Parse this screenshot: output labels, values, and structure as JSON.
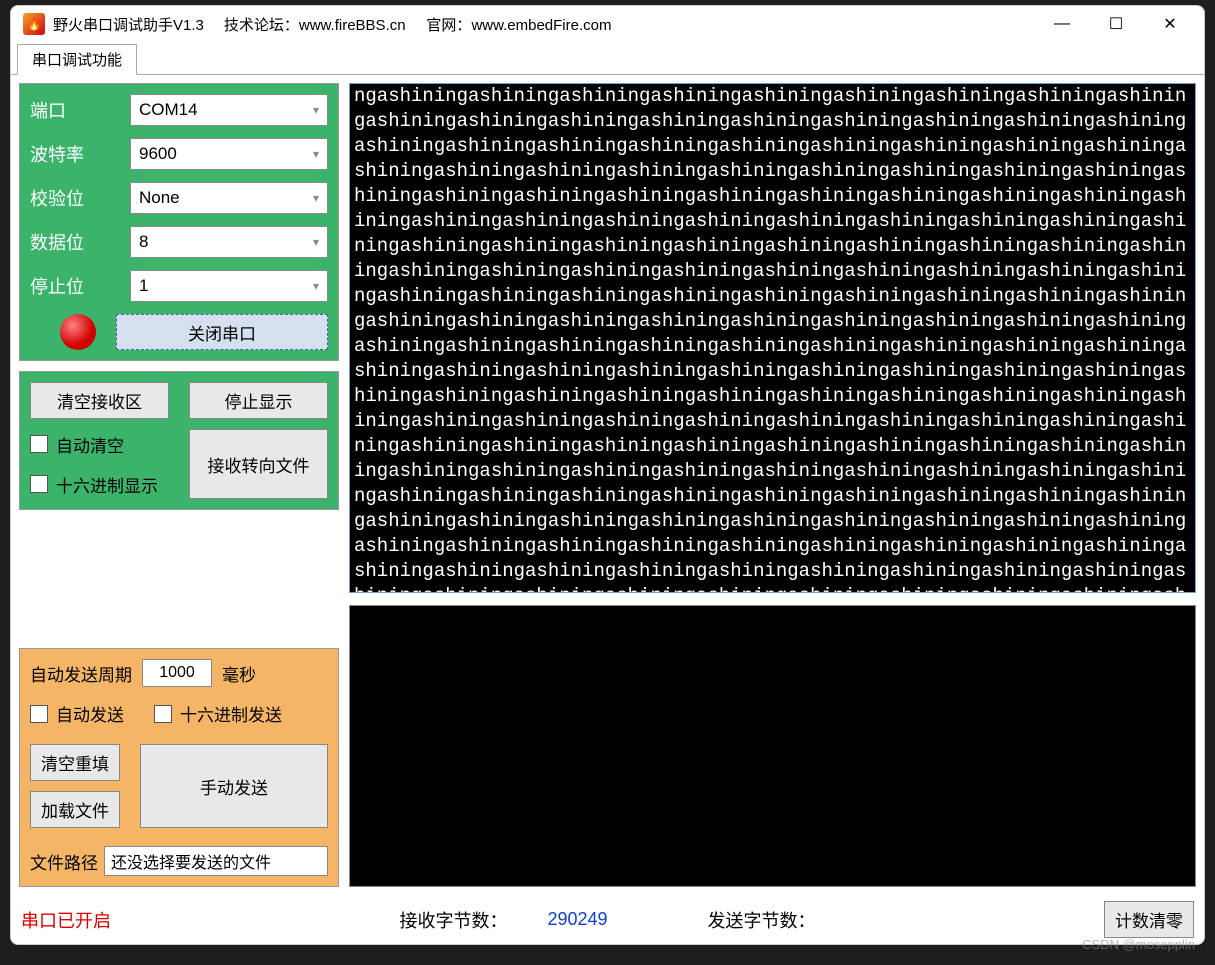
{
  "titlebar": {
    "app_title": "野火串口调试助手V1.3",
    "forum_label": "技术论坛：",
    "forum_url": "www.fireBBS.cn",
    "site_label": "官网：",
    "site_url": "www.embedFire.com"
  },
  "tabs": {
    "main": "串口调试功能"
  },
  "config": {
    "port_label": "端口",
    "port_value": "COM14",
    "baud_label": "波特率",
    "baud_value": "9600",
    "parity_label": "校验位",
    "parity_value": "None",
    "data_label": "数据位",
    "data_value": "8",
    "stop_label": "停止位",
    "stop_value": "1",
    "close_port": "关闭串口"
  },
  "rx_panel": {
    "clear": "清空接收区",
    "stop_disp": "停止显示",
    "auto_clear": "自动清空",
    "hex_disp": "十六进制显示",
    "to_file": "接收转向文件"
  },
  "tx_panel": {
    "auto_period_label": "自动发送周期",
    "period_value": "1000",
    "ms_label": "毫秒",
    "auto_send": "自动发送",
    "hex_send": "十六进制发送",
    "clear_refill": "清空重填",
    "load_file": "加载文件",
    "manual_send": "手动发送",
    "file_path_label": "文件路径",
    "file_path_value": "还没选择要发送的文件"
  },
  "terminal": {
    "content": "ngashiningashiningashiningashiningashiningashiningashiningashiningashiningashiningashiningashiningashiningashiningashiningashiningashiningashiningashiningashiningashiningashiningashiningashiningashiningashiningashiningashiningashiningashiningashiningashiningashiningashiningashiningashiningashiningashiningashiningashiningashiningashiningashiningashiningashiningashiningashiningashiningashiningashiningashiningashiningashiningashiningashiningashiningashiningashiningashiningashiningashiningashiningashiningashiningashiningashiningashiningashiningashiningashiningashiningashiningashiningashiningashiningashiningashiningashiningashiningashiningashiningashiningashiningashiningashiningashiningashiningashiningashiningashiningashiningashiningashiningashiningashiningashiningashiningashiningashiningashiningashiningashiningashiningashiningashiningashiningashiningashiningashiningashiningashiningashiningashiningashiningashiningashiningashiningashiningashiningashiningashiningashiningashiningashiningashiningashiningashiningashiningashiningashiningashiningashiningashiningashiningashiningashiningashiningashiningashiningashiningashiningashiningashiningashiningashiningashiningashiningashiningashiningashiningashiningashiningashiningashiningashiningashiningashiningashiningashiningashiningashiningashiningashiningashiningashiningashiningashiningashiningashiningashiningashiningashiningashiningashiningashiningashiningashiningashiningashiningashiningashiningashiningashiningashiningashiningashiningashiningashiningashiningashiningashiningashiningashiningashiningashiningashiningashiningashiningashiningashiningashiningashiningashiningashiningashiningashiningashiningashiningashiningashiningashiningashiningashiningashiningashiningashiningashiningashiningashiningashiningashiningashiningashiningashiningashiningashiningashiningashiningashiningashiningashiningashiningashiningashiningashiningashiningashiningashiningashiningashiningashiningashiningashiningashiningashiningashiningashiningashiningashiningashiningashiningashiningashiningashiningashiningashiningashiningashiningashiningashiningashiningashiningashiningashiningashiningashiningashiningashiningashiningashiningashiningashiningashiningashiningashiningashiningashiningashiningashiningashiningashiningashiningashiningashiningashiningashiningashiningashiningashiningashiningashiningashiningashiningashiningashiningashiningashiningashiningashiningashiningashiningashiningashiningashiningashiningashiningashiningashiningashiningashiningashiningashiningashiningashiningashiningashiningashiningashiningashiningashiningashiningashiningashiningashiningashiningashiningashiningashiningashiningashiningashiningashiningashiningashiningashiningashiningashiningashiningashiningashiningashiningashiningashiningashiningashiningashiningashiningashiningashiningashiningashiningashiningashiningashiningashiningashiningashiningashiningashiningashiningashiningashiningashiningashiningashiningashiningashiningashiningashiningashiningashiningashiningashiningashiningashiningashiningashiningashiningashiningashiningashiningashiningashiningashiningashiningashiningashiningashiningashiningashiningashiningashiningashiningashiningashiningashiningashiningashiningashiningashiningashiningashiningashiningashiningashiningashiningashiningashiningashiningashiningashiningashiningashiningashiningashiningashiningashiningashiningashiningashiningashiningashiningashiningashiningashiningashiningashiningashiningashiningashiningashiningashiningashiningashiningashiningashiningashiningashiningashiningashiningashiningashiningashiningashiningashiningashiningashiningashiningashiningashiningashiningashiningashiningashiningashiningashiningashiningashiningashiningashiningashiningashiningashiningashiningashiningashiningashiningashiningashiningashiningashiningashiningashiningashiningashiningashiningashiningashiningashiningashiningashiningashiningashiningashiningashiningashiningashiningashiningashiningashining"
  },
  "status": {
    "port_open": "串口已开启",
    "rx_label": "接收字节数：",
    "rx_count": "290249",
    "tx_label": "发送字节数：",
    "clear_count": "计数清零"
  },
  "watermark": "CSDN @mosepplin"
}
